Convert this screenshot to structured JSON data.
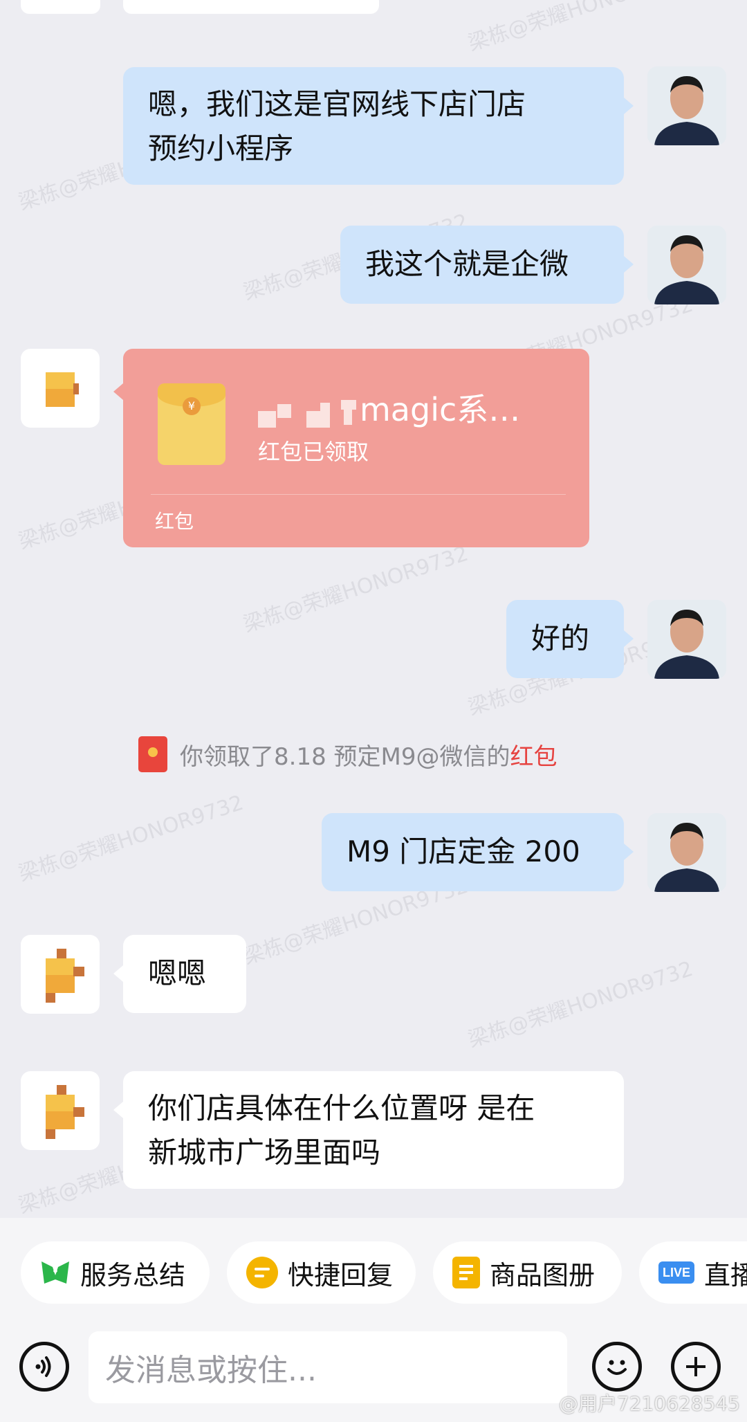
{
  "watermark": {
    "text": "梁栋@荣耀HONOR9732",
    "bottom_credit": "@用户7210628545"
  },
  "messages": [
    {
      "from": "me",
      "text_lines": [
        "嗯，我们这是官网线下店门店",
        "预约小程序"
      ]
    },
    {
      "from": "me",
      "text": "我这个就是企微"
    },
    {
      "from": "other",
      "type": "red-packet",
      "title": "magic系…",
      "status": "红包已领取",
      "footer": "红包"
    },
    {
      "from": "me",
      "text": "好的"
    },
    {
      "from": "system",
      "text_prefix": "你领取了8.18 预定M9@微信的",
      "text_link": "红包"
    },
    {
      "from": "me",
      "text": "M9 门店定金 200"
    },
    {
      "from": "other",
      "text": "嗯嗯"
    },
    {
      "from": "other",
      "text_lines": [
        "你们店具体在什么位置呀 是在",
        "新城市广场里面吗"
      ]
    }
  ],
  "quick_actions": [
    {
      "label": "服务总结",
      "icon": "service-summary-icon",
      "color": "#2bb64a"
    },
    {
      "label": "快捷回复",
      "icon": "quick-reply-icon",
      "color": "#f4b400"
    },
    {
      "label": "商品图册",
      "icon": "product-catalog-icon",
      "color": "#f4b400"
    },
    {
      "label": "直播",
      "icon": "live-icon",
      "color": "#3a8ef0"
    }
  ],
  "input": {
    "placeholder": "发消息或按住..."
  },
  "colors": {
    "background": "#ededf2",
    "my_bubble": "#cfe4fb",
    "red_packet": "#f29e98",
    "link_red": "#e64340"
  }
}
